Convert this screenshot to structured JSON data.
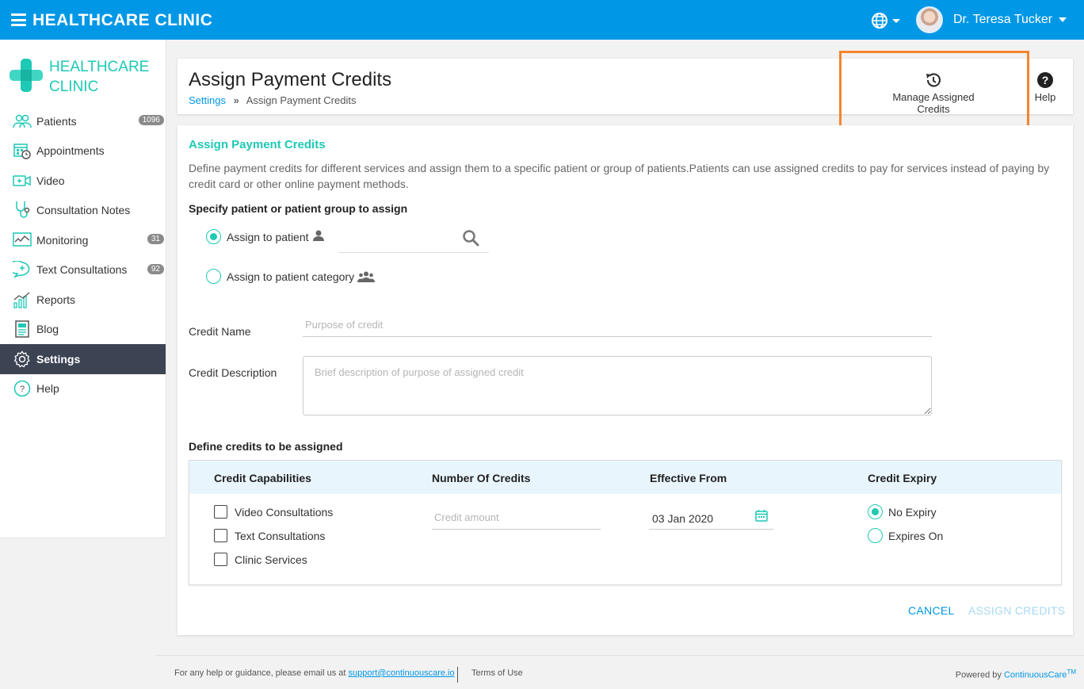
{
  "topbar": {
    "app_title": "HEALTHCARE CLINIC",
    "user_name": "Dr. Teresa Tucker"
  },
  "sidebar": {
    "logo_line1": "HEALTHCARE",
    "logo_line2": "CLINIC",
    "items": [
      {
        "label": "Patients",
        "badge": "1096",
        "icon": "patients-icon"
      },
      {
        "label": "Appointments",
        "badge": "",
        "icon": "calendar-icon"
      },
      {
        "label": "Video",
        "badge": "",
        "icon": "video-icon"
      },
      {
        "label": "Consultation Notes",
        "badge": "",
        "icon": "stethoscope-icon"
      },
      {
        "label": "Monitoring",
        "badge": "31",
        "icon": "monitoring-icon"
      },
      {
        "label": "Text Consultations",
        "badge": "92",
        "icon": "chat-icon"
      },
      {
        "label": "Reports",
        "badge": "",
        "icon": "reports-icon"
      },
      {
        "label": "Blog",
        "badge": "",
        "icon": "blog-icon"
      },
      {
        "label": "Settings",
        "badge": "",
        "icon": "gear-icon"
      },
      {
        "label": "Help",
        "badge": "",
        "icon": "help-icon"
      }
    ]
  },
  "header": {
    "title": "Assign Payment Credits",
    "breadcrumb_link": "Settings",
    "breadcrumb_current": "Assign Payment Credits",
    "manage_label": "Manage Assigned Credits",
    "help_label": "Help"
  },
  "form": {
    "section_title": "Assign Payment Credits",
    "description": "Define payment credits for different services and assign them to a specific patient or group of patients.Patients can use assigned credits to pay for services instead of paying by credit card or other online payment methods.",
    "assign_heading": "Specify patient or patient group to assign",
    "assign_patient_label": "Assign to patient",
    "assign_category_label": "Assign to patient category",
    "credit_name_label": "Credit Name",
    "credit_name_placeholder": "Purpose of credit",
    "credit_desc_label": "Credit Description",
    "credit_desc_placeholder": "Brief description of purpose of assigned credit",
    "define_heading": "Define credits to be assigned",
    "table": {
      "headers": [
        "Credit Capabilities",
        "Number Of Credits",
        "Effective From",
        "Credit Expiry"
      ],
      "capabilities": [
        "Video Consultations",
        "Text Consultations",
        "Clinic Services"
      ],
      "credit_amount_placeholder": "Credit amount",
      "effective_from": "03 Jan 2020",
      "expiry_options": [
        "No Expiry",
        "Expires On"
      ]
    },
    "cancel_label": "CANCEL",
    "assign_label": "ASSIGN CREDITS"
  },
  "footer": {
    "help_text": "For any help or guidance, please email us at",
    "support_email": "support@continuouscare.io",
    "terms": "Terms of Use",
    "powered_by": "Powered by",
    "brand": "ContinuousCare",
    "tm": "TM"
  },
  "colors": {
    "brand_blue": "#0097e6",
    "accent_teal": "#1ec9b5",
    "sidebar_active": "#3c4454",
    "highlight": "#f5852c"
  }
}
